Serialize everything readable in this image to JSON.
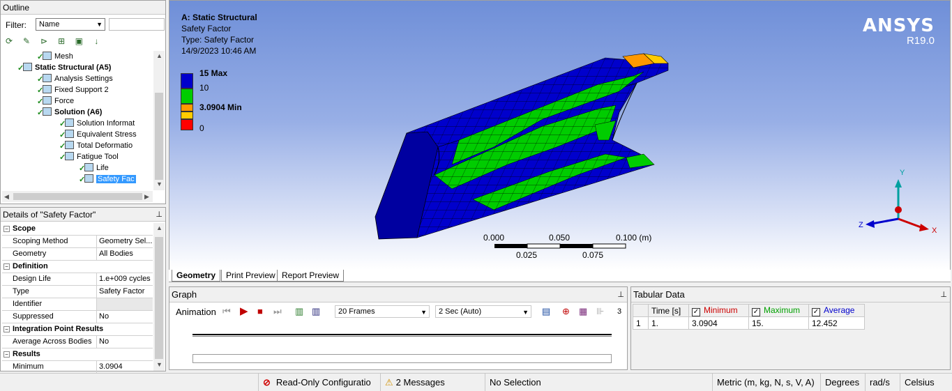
{
  "outline": {
    "title": "Outline",
    "filter_label": "Filter:",
    "filter_value": "Name",
    "tree": [
      {
        "label": "Mesh",
        "depth": 3,
        "bold": false
      },
      {
        "label": "Static Structural (A5)",
        "depth": 2,
        "bold": true
      },
      {
        "label": "Analysis Settings",
        "depth": 3,
        "bold": false
      },
      {
        "label": "Fixed Support 2",
        "depth": 3,
        "bold": false
      },
      {
        "label": "Force",
        "depth": 3,
        "bold": false
      },
      {
        "label": "Solution (A6)",
        "depth": 3,
        "bold": true
      },
      {
        "label": "Solution Informat",
        "depth": 4,
        "bold": false
      },
      {
        "label": "Equivalent Stress",
        "depth": 4,
        "bold": false
      },
      {
        "label": "Total Deformatio",
        "depth": 4,
        "bold": false
      },
      {
        "label": "Fatigue Tool",
        "depth": 4,
        "bold": false
      },
      {
        "label": "Life",
        "depth": 5,
        "bold": false
      },
      {
        "label": "Safety Fac",
        "depth": 5,
        "bold": false
      }
    ]
  },
  "details": {
    "title": "Details of \"Safety Factor\"",
    "rows": [
      {
        "group": true,
        "key": "Scope"
      },
      {
        "key": "Scoping Method",
        "value": "Geometry Sel..."
      },
      {
        "key": "Geometry",
        "value": "All Bodies"
      },
      {
        "group": true,
        "key": "Definition"
      },
      {
        "key": "Design Life",
        "value": "1.e+009 cycles"
      },
      {
        "key": "Type",
        "value": "Safety Factor"
      },
      {
        "key": "Identifier",
        "value": ""
      },
      {
        "key": "Suppressed",
        "value": "No"
      },
      {
        "group": true,
        "key": "Integration Point Results"
      },
      {
        "key": "Average Across Bodies",
        "value": "No"
      },
      {
        "group": true,
        "key": "Results"
      },
      {
        "key": "Minimum",
        "value": "3.0904"
      }
    ]
  },
  "viewport": {
    "title": "A: Static Structural",
    "result_name": "Safety Factor",
    "type_line": "Type: Safety Factor",
    "timestamp": "14/9/2023 10:46 AM",
    "legend": [
      {
        "label": "15 Max",
        "bold": true,
        "color": "#0000cc"
      },
      {
        "label": "10",
        "bold": false,
        "color": "#00cc00"
      },
      {
        "label": "3.0904 Min",
        "bold": true,
        "color": "#ff9900"
      },
      {
        "label": "0",
        "bold": false,
        "color": "#ff0000"
      }
    ],
    "brand": "ANSYS",
    "version": "R19.0",
    "scale": {
      "top": [
        "0.000",
        "0.050",
        "0.100 (m)"
      ],
      "bottom": [
        "0.025",
        "0.075"
      ]
    },
    "axes": {
      "x": "X",
      "y": "Y",
      "z": "Z"
    }
  },
  "view_tabs": [
    "Geometry",
    "Print Preview",
    "Report Preview"
  ],
  "graph": {
    "title": "Graph",
    "animation_label": "Animation",
    "frames": "20 Frames",
    "duration": "2 Sec (Auto)",
    "frame_count": "3"
  },
  "tabular": {
    "title": "Tabular Data",
    "headers": [
      "Time [s]",
      "Minimum",
      "Maximum",
      "Average"
    ],
    "header_colors": [
      "#000000",
      "#cc0000",
      "#00a000",
      "#0000cc"
    ],
    "rows": [
      [
        "1",
        "1.",
        "3.0904",
        "15.",
        "12.452"
      ]
    ]
  },
  "status": {
    "readonly": "Read-Only Configuratio",
    "messages": "2 Messages",
    "selection": "No Selection",
    "units": "Metric (m, kg, N, s, V, A)",
    "angle": "Degrees",
    "rate": "rad/s",
    "temp": "Celsius"
  },
  "colors": {
    "mesh_blue": "#0000cc",
    "mesh_green": "#00cc00",
    "mesh_orange": "#ff9900",
    "selection": "#3399ff"
  }
}
